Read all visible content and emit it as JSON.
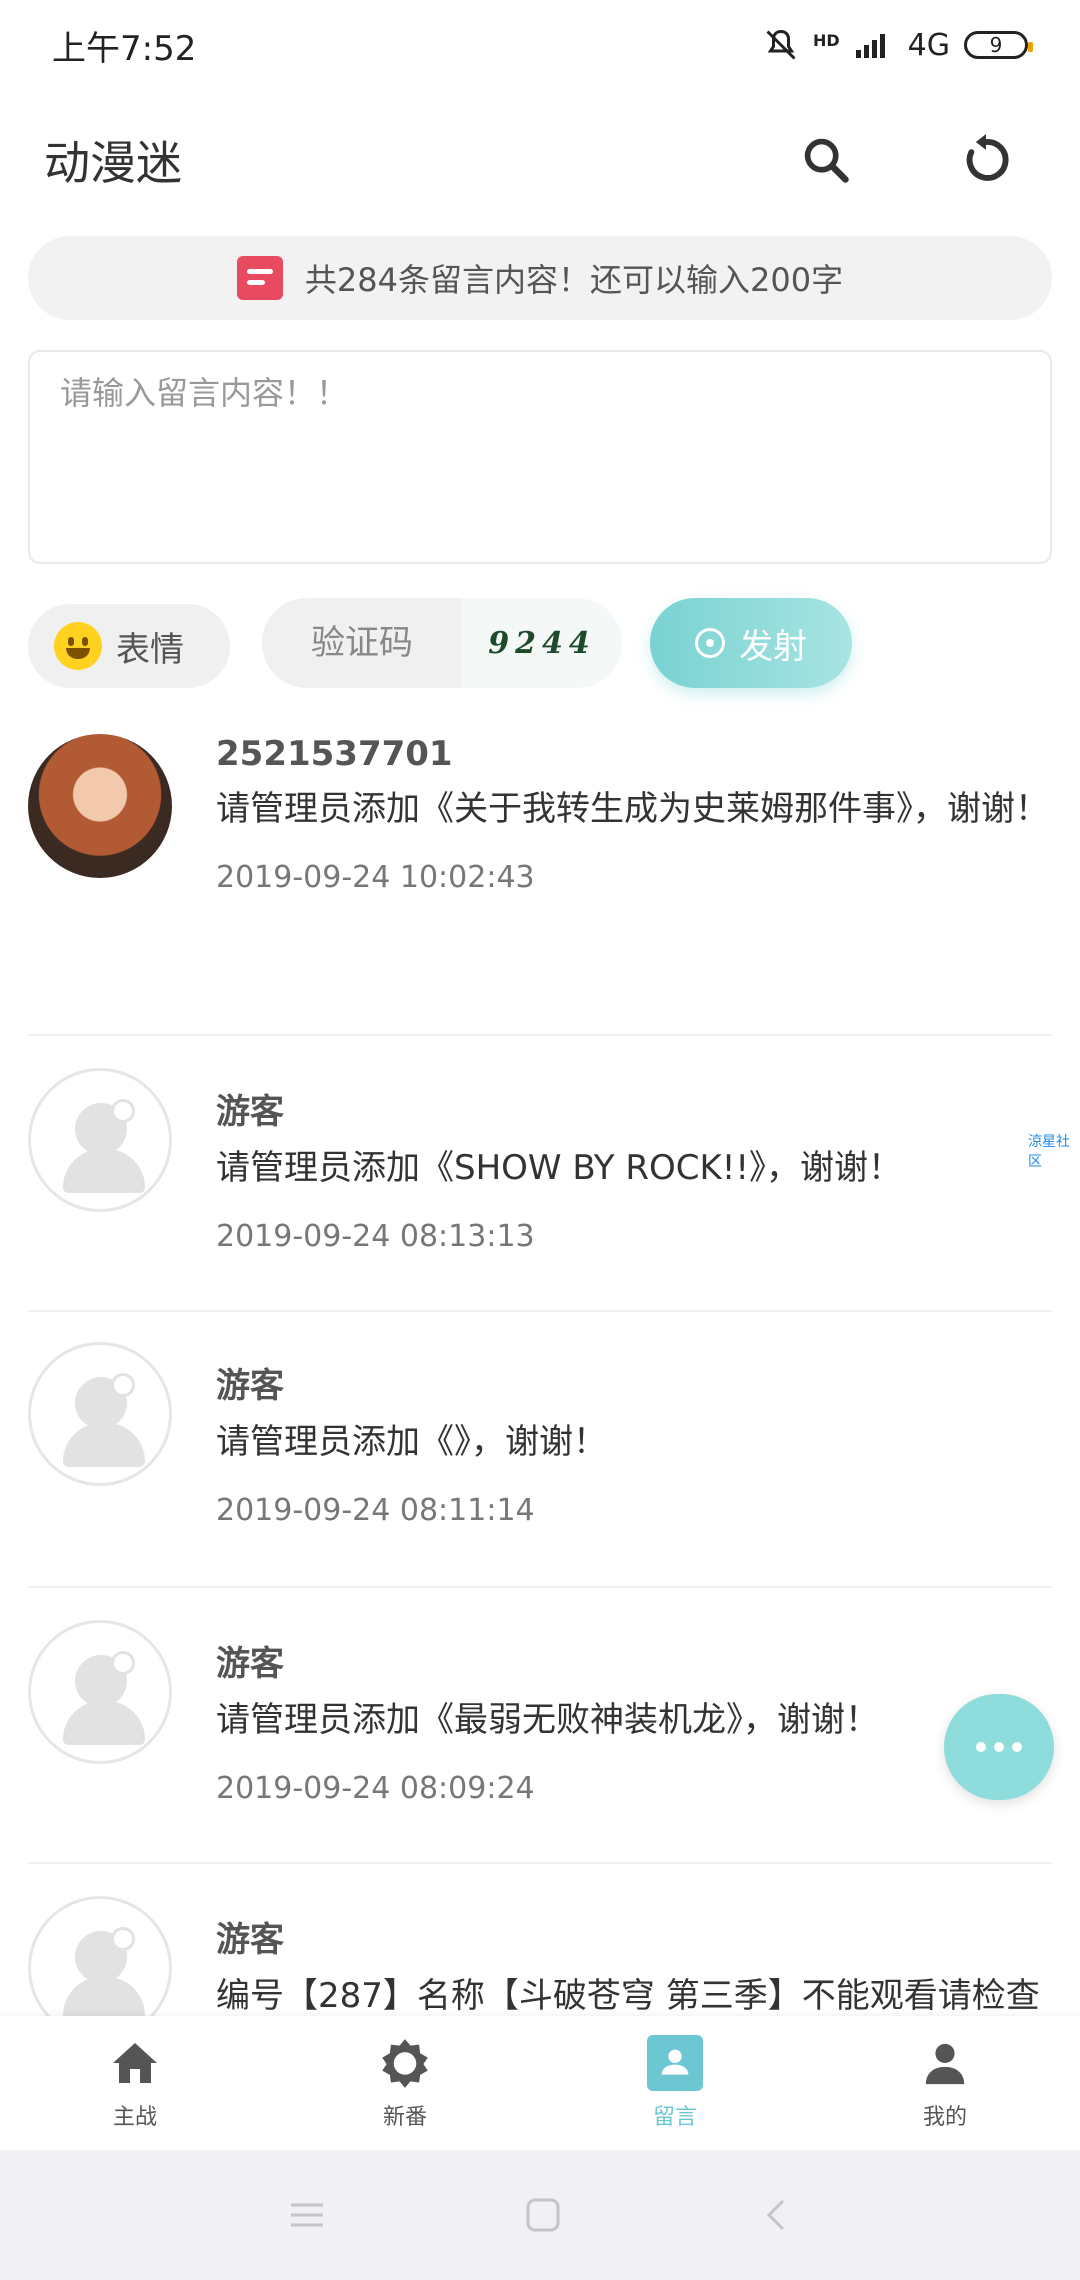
{
  "status_bar": {
    "time": "上午7:52",
    "network": "4G",
    "hd_label": "HD",
    "battery": "9"
  },
  "app_bar": {
    "title": "动漫迷",
    "icons": [
      "search-icon",
      "refresh-icon"
    ]
  },
  "notice": {
    "text": "共284条留言内容！还可以输入200字"
  },
  "composer": {
    "placeholder": "请输入留言内容！！",
    "emoji_label": "表情",
    "captcha_placeholder": "验证码",
    "captcha_text": "9244",
    "send_label": "发射",
    "accent": "#79d2d2"
  },
  "comments": [
    {
      "user": "2521537701",
      "text": "请管理员添加《关于我转生成为史莱姆那件事》，谢谢！",
      "time": "2019-09-24 10:02:43",
      "avatar": "photo"
    },
    {
      "user": "游客",
      "text": "请管理员添加《SHOW BY ROCK!!》，谢谢！",
      "time": "2019-09-24 08:13:13",
      "avatar": "guest"
    },
    {
      "user": "游客",
      "text": "请管理员添加《》，谢谢！",
      "time": "2019-09-24 08:11:14",
      "avatar": "guest"
    },
    {
      "user": "游客",
      "text": "请管理员添加《最弱无败神装机龙》，谢谢！",
      "time": "2019-09-24 08:09:24",
      "avatar": "guest"
    },
    {
      "user": "游客",
      "text": "编号【287】名称【斗破苍穹 第三季】不能观看请检查",
      "time": "",
      "avatar": "guest"
    }
  ],
  "side_watermark": "涼星社区",
  "bottom_nav": {
    "items": [
      {
        "label": "主战",
        "icon": "home-icon"
      },
      {
        "label": "新番",
        "icon": "gear-icon"
      },
      {
        "label": "留言",
        "icon": "message-icon"
      },
      {
        "label": "我的",
        "icon": "person-icon"
      }
    ],
    "active": "留言",
    "active_color": "#6cc7d3"
  }
}
